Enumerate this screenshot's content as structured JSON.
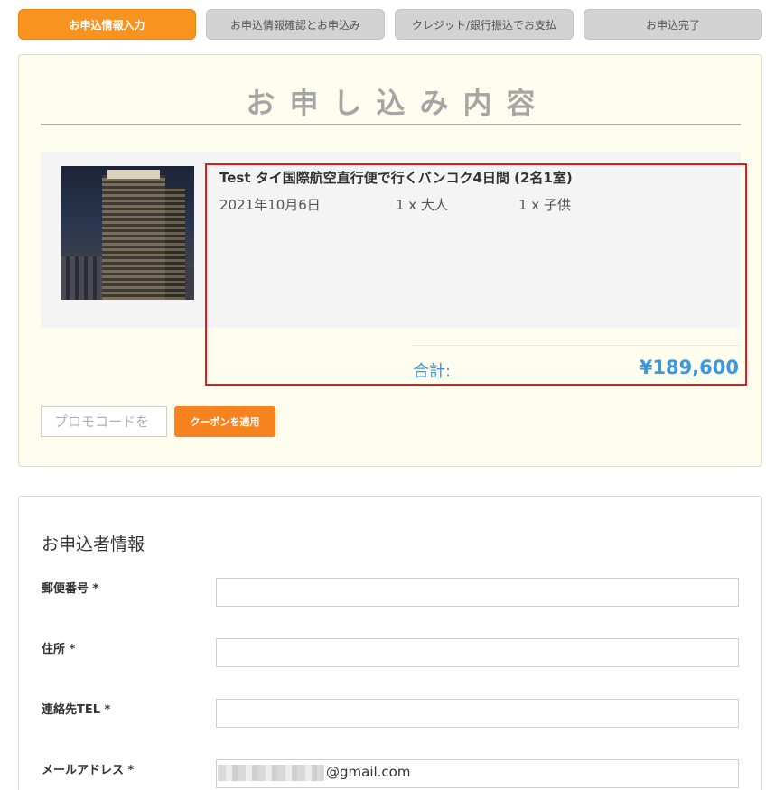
{
  "steps": [
    {
      "label": "お申込情報入力",
      "active": true
    },
    {
      "label": "お申込情報確認とお申込み",
      "active": false
    },
    {
      "label": "クレジット/銀行振込でお支払",
      "active": false
    },
    {
      "label": "お申込完了",
      "active": false
    }
  ],
  "order": {
    "title": "お申し込み内容",
    "product_name": "Test タイ国際航空直行便で行くバンコク4日間 (2名1室)",
    "date": "2021年10月6日",
    "adults": "1 x 大人",
    "children": "1 x 子供",
    "total_label": "合計:",
    "total_value": "¥189,600"
  },
  "promo": {
    "placeholder": "プロモコードを",
    "button_label": "クーポンを適用"
  },
  "applicant": {
    "title": "お申込者情報",
    "fields": [
      {
        "label": "郵便番号 *",
        "value": ""
      },
      {
        "label": "住所 *",
        "value": ""
      },
      {
        "label": "連絡先TEL *",
        "value": ""
      },
      {
        "label": "メールアドレス *",
        "value": "@gmail.com"
      }
    ]
  },
  "colors": {
    "accent": "#f7931e",
    "total": "#3a98e0",
    "highlight": "#e01b1b",
    "panel_bg": "#fffdee"
  }
}
